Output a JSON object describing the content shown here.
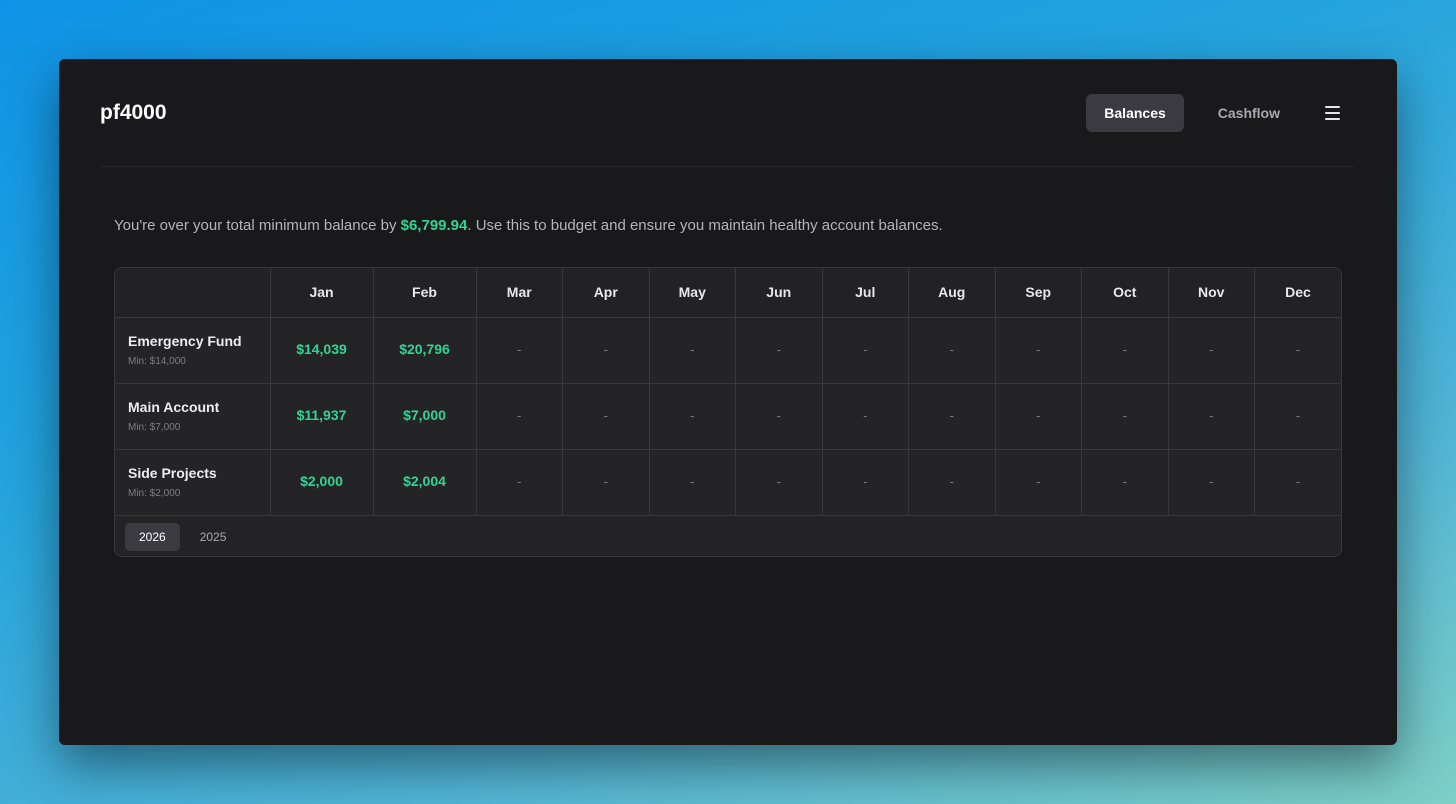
{
  "app": {
    "brand": "pf4000"
  },
  "nav": {
    "tabs": [
      {
        "label": "Balances",
        "active": true
      },
      {
        "label": "Cashflow",
        "active": false
      }
    ],
    "menu_icon": "hamburger-icon"
  },
  "summary": {
    "prefix": "You're over your total minimum balance by ",
    "amount": "$6,799.94",
    "suffix": ". Use this to budget and ensure you maintain healthy account balances."
  },
  "table": {
    "months": [
      "Jan",
      "Feb",
      "Mar",
      "Apr",
      "May",
      "Jun",
      "Jul",
      "Aug",
      "Sep",
      "Oct",
      "Nov",
      "Dec"
    ],
    "rows": [
      {
        "name": "Emergency Fund",
        "min": "Min: $14,000",
        "values": [
          "$14,039",
          "$20,796",
          "-",
          "-",
          "-",
          "-",
          "-",
          "-",
          "-",
          "-",
          "-",
          "-"
        ]
      },
      {
        "name": "Main Account",
        "min": "Min: $7,000",
        "values": [
          "$11,937",
          "$7,000",
          "-",
          "-",
          "-",
          "-",
          "-",
          "-",
          "-",
          "-",
          "-",
          "-"
        ]
      },
      {
        "name": "Side Projects",
        "min": "Min: $2,000",
        "values": [
          "$2,000",
          "$2,004",
          "-",
          "-",
          "-",
          "-",
          "-",
          "-",
          "-",
          "-",
          "-",
          "-"
        ]
      }
    ]
  },
  "years": [
    {
      "label": "2026",
      "active": true
    },
    {
      "label": "2025",
      "active": false
    }
  ],
  "colors": {
    "positive": "#2ed692",
    "background": "#19191b",
    "active_tab": "#3a3a40"
  }
}
